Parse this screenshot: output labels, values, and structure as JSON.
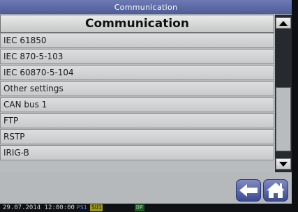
{
  "window": {
    "title": "Communication"
  },
  "header": {
    "title": "Communication"
  },
  "menu": {
    "items": [
      "IEC 61850",
      "IEC 870-5-103",
      "IEC 60870-5-104",
      "Other settings",
      "CAN bus 1",
      "FTP",
      "RSTP",
      "IRIG-B"
    ]
  },
  "scrollbar": {
    "up_icon": "triangle-up",
    "down_icon": "triangle-down"
  },
  "nav": {
    "back_icon": "arrow-left-icon",
    "home_icon": "home-icon"
  },
  "status": {
    "datetime": "29.07.2014 12:00:00",
    "ps1": "PS1",
    "su1": "SU1",
    "dp": "DP"
  }
}
